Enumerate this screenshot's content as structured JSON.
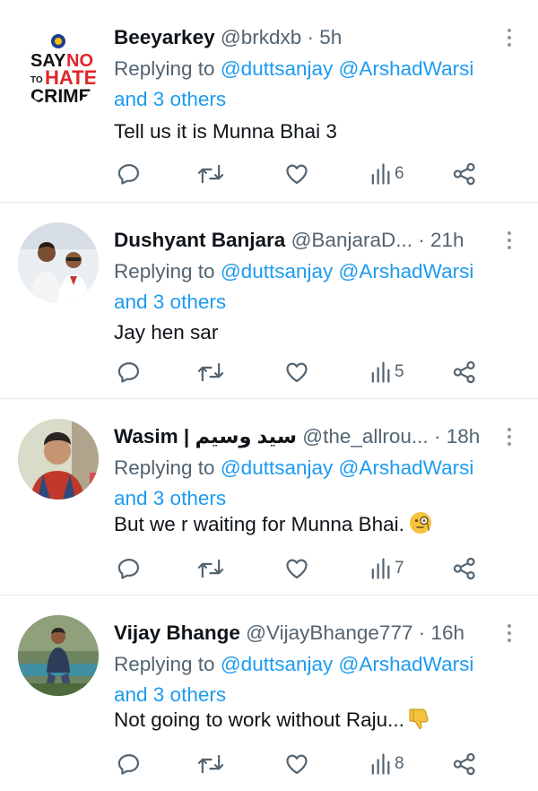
{
  "tweets": [
    {
      "name": "Beeyarkey",
      "handle": "@brkdxb",
      "separator": "·",
      "time": "5h",
      "replying_prefix": "Replying to",
      "mention1": "@duttsanjay",
      "mention2": "@ArshadWarsi",
      "and_others": "and 3 others",
      "text": "Tell us it is Munna Bhai 3",
      "views": "6",
      "avatar": {
        "kind": "logo",
        "lines": [
          "SAY NO",
          "TO HATE",
          "CRIME"
        ]
      }
    },
    {
      "name": "Dushyant Banjara",
      "handle": "@BanjaraD...",
      "separator": "·",
      "time": "21h",
      "replying_prefix": "Replying to",
      "mention1": "@duttsanjay",
      "mention2": "@ArshadWarsi",
      "and_others": "and 3 others",
      "text": "Jay hen sar",
      "views": "5",
      "avatar": {
        "kind": "photo"
      }
    },
    {
      "name": "Wasim | سيد وسيم",
      "handle": "@the_allrou...",
      "separator": "·",
      "time": "18h",
      "replying_prefix": "Replying to",
      "mention1": "@duttsanjay",
      "mention2": "@ArshadWarsi",
      "and_others": "and 3 others",
      "text": "But we r waiting for Munna Bhai.",
      "text_emoji": "face-with-monocle",
      "views": "7",
      "avatar": {
        "kind": "photo"
      }
    },
    {
      "name": "Vijay Bhange",
      "handle": "@VijayBhange777",
      "separator": "·",
      "time": "16h",
      "replying_prefix": "Replying to",
      "mention1": "@duttsanjay",
      "mention2": "@ArshadWarsi",
      "and_others": "and 3 others",
      "text": "Not going to work without Raju...",
      "text_emoji": "thumbs-down",
      "views": "8",
      "avatar": {
        "kind": "photo"
      }
    }
  ],
  "icons": {
    "reply": "reply-icon",
    "retweet": "retweet-icon",
    "like": "heart-icon",
    "views": "views-icon",
    "share": "share-icon",
    "more": "more-icon"
  },
  "colors": {
    "link": "#1d9bf0",
    "secondary": "#536471",
    "divider": "#e6e9eb"
  }
}
